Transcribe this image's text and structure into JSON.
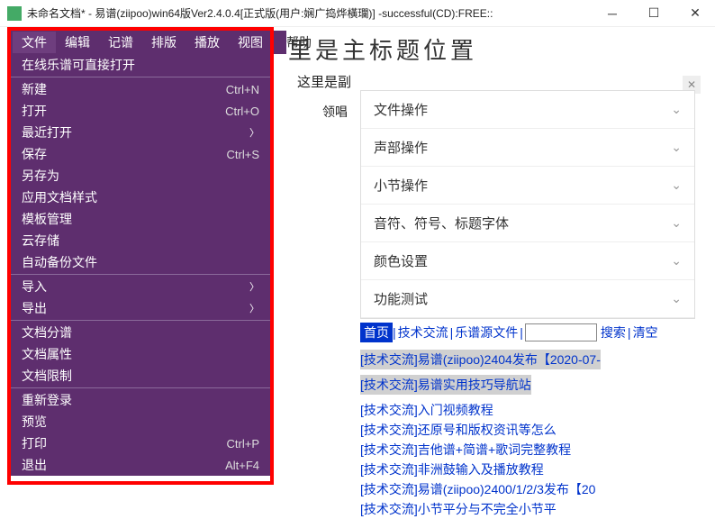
{
  "titlebar": {
    "text": "未命名文档* - 易谱(ziipoo)win64版Ver2.4.0.4[正式版(用户:娴广捣烨橫瓓)] -successful(CD):FREE::"
  },
  "menubar": {
    "items": [
      "文件",
      "编辑",
      "记谱",
      "排版",
      "播放",
      "视图"
    ],
    "help": "帮助"
  },
  "dropdown": {
    "online": "在线乐谱可直接打开",
    "new": "新建",
    "new_sc": "Ctrl+N",
    "open": "打开",
    "open_sc": "Ctrl+O",
    "recent": "最近打开",
    "save": "保存",
    "save_sc": "Ctrl+S",
    "saveas": "另存为",
    "docstyle": "应用文档样式",
    "template": "模板管理",
    "cloud": "云存储",
    "autobackup": "自动备份文件",
    "import": "导入",
    "export": "导出",
    "docsplit": "文档分谱",
    "docprop": "文档属性",
    "doclimit": "文档限制",
    "relogin": "重新登录",
    "preview": "预览",
    "print": "打印",
    "print_sc": "Ctrl+P",
    "exit": "退出",
    "exit_sc": "Alt+F4"
  },
  "doc": {
    "title_partial": "里是主标题位置",
    "subtitle_partial": "这里是副",
    "lead": "领唱"
  },
  "accordion": {
    "a0": "文件操作",
    "a1": "声部操作",
    "a2": "小节操作",
    "a3": "音符、符号、标题字体",
    "a4": "颜色设置",
    "a5": "功能测试"
  },
  "nav": {
    "home": "首页",
    "tech": "技术交流",
    "source": "乐谱源文件",
    "search": "搜索",
    "clear": "清空"
  },
  "posts": {
    "p0": "[技术交流]易谱(ziipoo)2404发布【2020-07-",
    "p1": "[技术交流]易谱实用技巧导航站",
    "p2": "[技术交流]入门视频教程",
    "p3": "[技术交流]还原号和版权资讯等怎么",
    "p4": "[技术交流]吉他谱+简谱+歌词完整教程",
    "p5": "[技术交流]非洲鼓输入及播放教程",
    "p6": "[技术交流]易谱(ziipoo)2400/1/2/3发布【20",
    "p7": "[技术交流]小节平分与不完全小节平"
  }
}
